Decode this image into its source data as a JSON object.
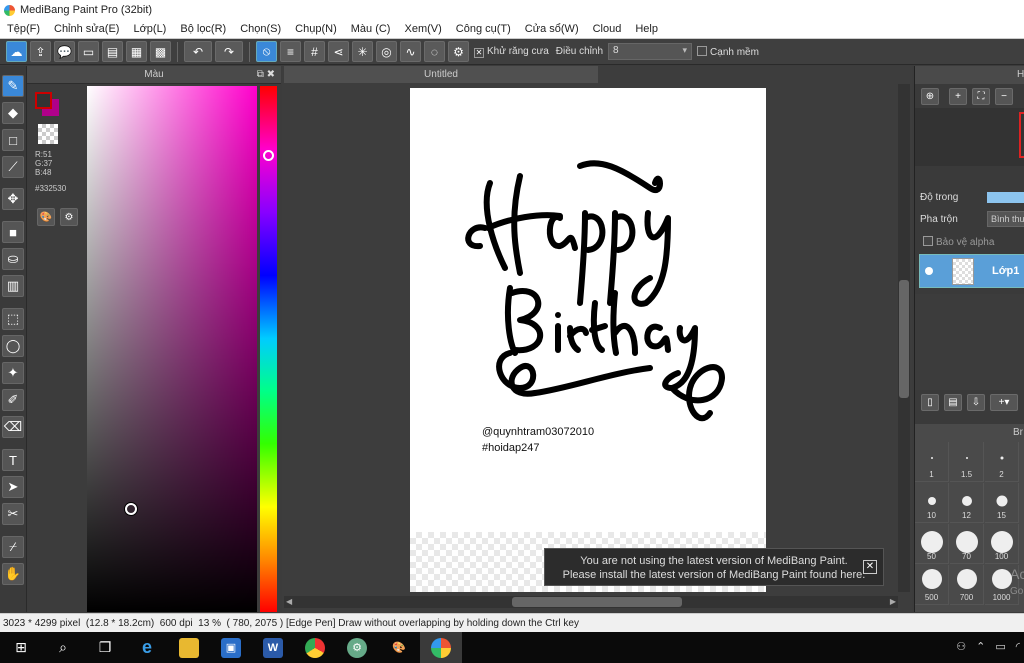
{
  "window": {
    "title": "MediBang Paint Pro (32bit)"
  },
  "menu": [
    "Tệp(F)",
    "Chỉnh sửa(E)",
    "Lớp(L)",
    "Bộ lọc(R)",
    "Chọn(S)",
    "Chụp(N)",
    "Màu (C)",
    "Xem(V)",
    "Công cụ(T)",
    "Cửa sổ(W)",
    "Cloud",
    "Help"
  ],
  "toolbar": {
    "antialias_label": "Khử răng cưa",
    "correction_label": "Điều chỉnh",
    "correction_value": "8",
    "soft_edge_label": "Cạnh mềm"
  },
  "color_panel": {
    "title": "Màu",
    "r": "R:51",
    "g": "G:37",
    "b": "B:48",
    "hex": "#332530",
    "fg_color": "#333333",
    "bg_color": "#b0008a"
  },
  "canvas": {
    "tab_title": "Untitled",
    "artwork_title": "Happy Birthday",
    "credit_line1": "@quynhtram03072010",
    "credit_line2": "#hoidap247"
  },
  "notice": {
    "line1": "You are not using the latest version of MediBang Paint.",
    "line2": "Please install the latest version of MediBang Paint found here."
  },
  "layer_panel": {
    "header": "H",
    "opacity_label": "Độ trong",
    "blend_label": "Pha trộn",
    "blend_value": "Bình thư",
    "protect_alpha_label": "Bảo vệ alpha",
    "layer_name": "Lớp1"
  },
  "brush_panel": {
    "header": "Br",
    "sizes": [
      "1",
      "1.5",
      "2",
      "10",
      "12",
      "15",
      "50",
      "70",
      "100",
      "500",
      "700",
      "1000"
    ]
  },
  "watermark": {
    "line1": "Activate Win",
    "line2": "Go to Settings to"
  },
  "status": {
    "size": "3023 * 4299 pixel",
    "cm": "(12.8 * 18.2cm)",
    "dpi": "600 dpi",
    "zoom": "13 %",
    "coords": "( 780, 2075 )",
    "hint": "[Edge Pen] Draw without overlapping by holding down the Ctrl key"
  }
}
